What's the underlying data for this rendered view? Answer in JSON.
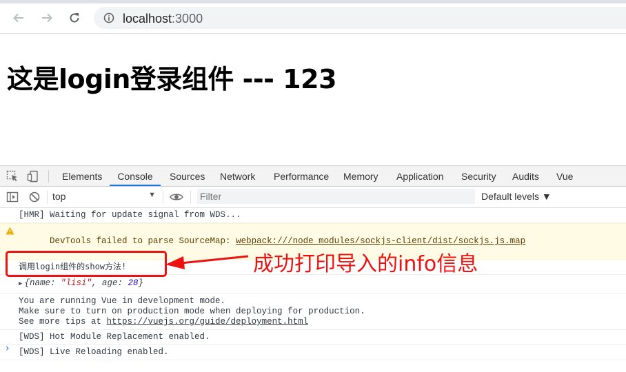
{
  "browser": {
    "url_host": "localhost",
    "url_port": ":3000",
    "icons": {
      "back": "back-arrow-icon",
      "forward": "forward-arrow-icon",
      "reload": "reload-icon",
      "info": "info-icon"
    }
  },
  "page": {
    "title": "这是login登录组件 --- 123"
  },
  "devtools": {
    "tabs": [
      "Elements",
      "Console",
      "Sources",
      "Network",
      "Performance",
      "Memory",
      "Application",
      "Security",
      "Audits",
      "Vue"
    ],
    "active_tab": "Console",
    "toolbar": {
      "context": "top",
      "filter_placeholder": "Filter",
      "levels": "Default levels ▼"
    },
    "console": {
      "line1": "[HMR] Waiting for update signal from WDS...",
      "warn_prefix": "DevTools failed to parse SourceMap: ",
      "warn_link": "webpack:///node_modules/sockjs-client/dist/sockjs.js.map",
      "line_show": "调用login组件的show方法!",
      "obj": {
        "open": "{",
        "key1": "name",
        "val1": "\"lisi\"",
        "key2": "age",
        "val2": "28",
        "close": "}"
      },
      "vue1": "You are running Vue in development mode.",
      "vue2": "Make sure to turn on production mode when deploying for production.",
      "vue3_prefix": "See more tips at ",
      "vue3_link": "https://vuejs.org/guide/deployment.html",
      "wds1": "[WDS] Hot Module Replacement enabled.",
      "wds2": "[WDS] Live Reloading enabled.",
      "prompt": "›"
    }
  },
  "annotation": {
    "text": "成功打印导入的info信息",
    "color": "#ee1111"
  }
}
